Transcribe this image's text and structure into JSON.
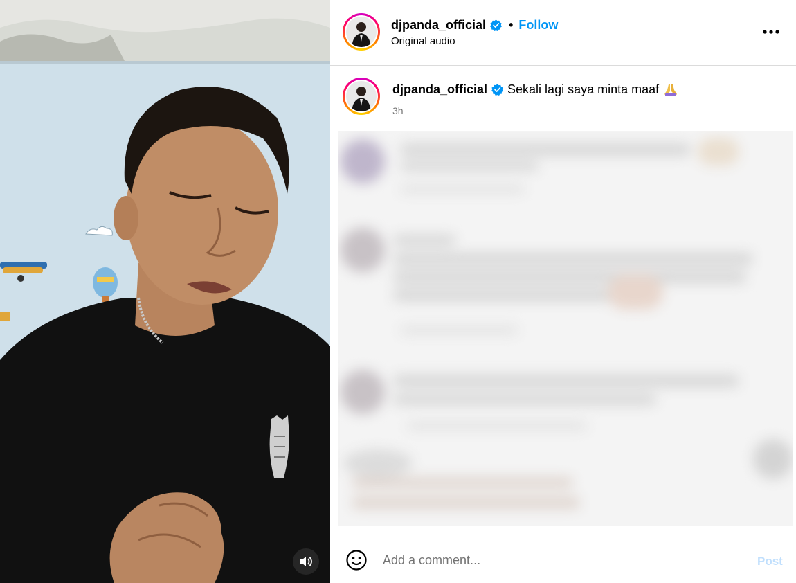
{
  "post": {
    "username": "djpanda_official",
    "verified": true,
    "follow_label": "Follow",
    "separator": "•",
    "audio_label": "Original audio",
    "more_icon": "more-horizontal-icon"
  },
  "caption": {
    "username": "djpanda_official",
    "text": "Sekali lagi saya minta maaf",
    "emoji": "folded-hands-emoji",
    "time": "3h"
  },
  "comment_box": {
    "placeholder": "Add a comment...",
    "post_label": "Post",
    "emoji_icon": "smiley-icon"
  },
  "video": {
    "mute_icon": "speaker-icon"
  },
  "colors": {
    "link_blue": "#0095f6",
    "post_disabled": "#c0dffd",
    "verified_blue": "#0095f6"
  }
}
